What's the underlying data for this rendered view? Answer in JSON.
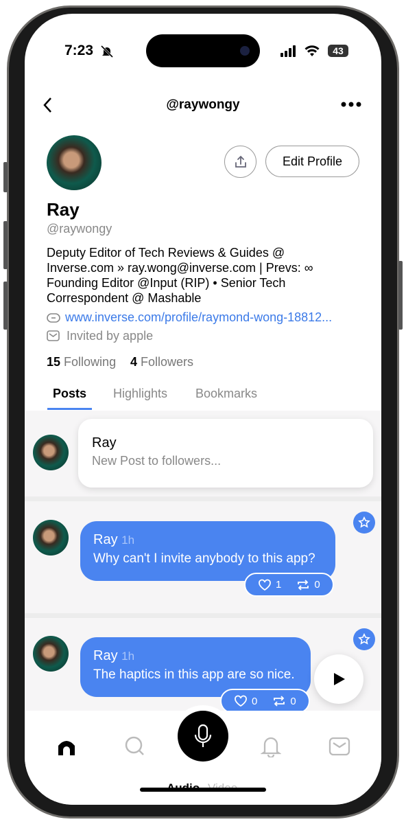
{
  "status": {
    "time": "7:23",
    "battery": "43"
  },
  "nav": {
    "title": "@raywongy"
  },
  "profile": {
    "name": "Ray",
    "handle": "@raywongy",
    "edit_label": "Edit Profile",
    "bio": [
      "Deputy Editor of Tech Reviews & Guides @",
      "Inverse.com » ray.wong@inverse.com | Prevs: ∞",
      "Founding Editor @Input (RIP) • Senior Tech",
      "Correspondent @ Mashable"
    ],
    "link": "www.inverse.com/profile/raymond-wong-18812...",
    "invited": "Invited by apple",
    "following_count": "15",
    "following_label": "Following",
    "followers_count": "4",
    "followers_label": "Followers"
  },
  "tabs": [
    {
      "label": "Posts",
      "active": true
    },
    {
      "label": "Highlights"
    },
    {
      "label": "Bookmarks"
    }
  ],
  "composer": {
    "name": "Ray",
    "placeholder": "New Post to followers..."
  },
  "posts": [
    {
      "name": "Ray",
      "time": "1h",
      "text": "Why can't I invite anybody to this app?",
      "likes": "1",
      "reposts": "0"
    },
    {
      "name": "Ray",
      "time": "1h",
      "text": "The haptics in this app are so nice.",
      "likes": "0",
      "reposts": "0"
    }
  ],
  "bottom": {
    "audio": "Audio",
    "video": "Video"
  },
  "colors": {
    "accent": "#4a84f0"
  }
}
